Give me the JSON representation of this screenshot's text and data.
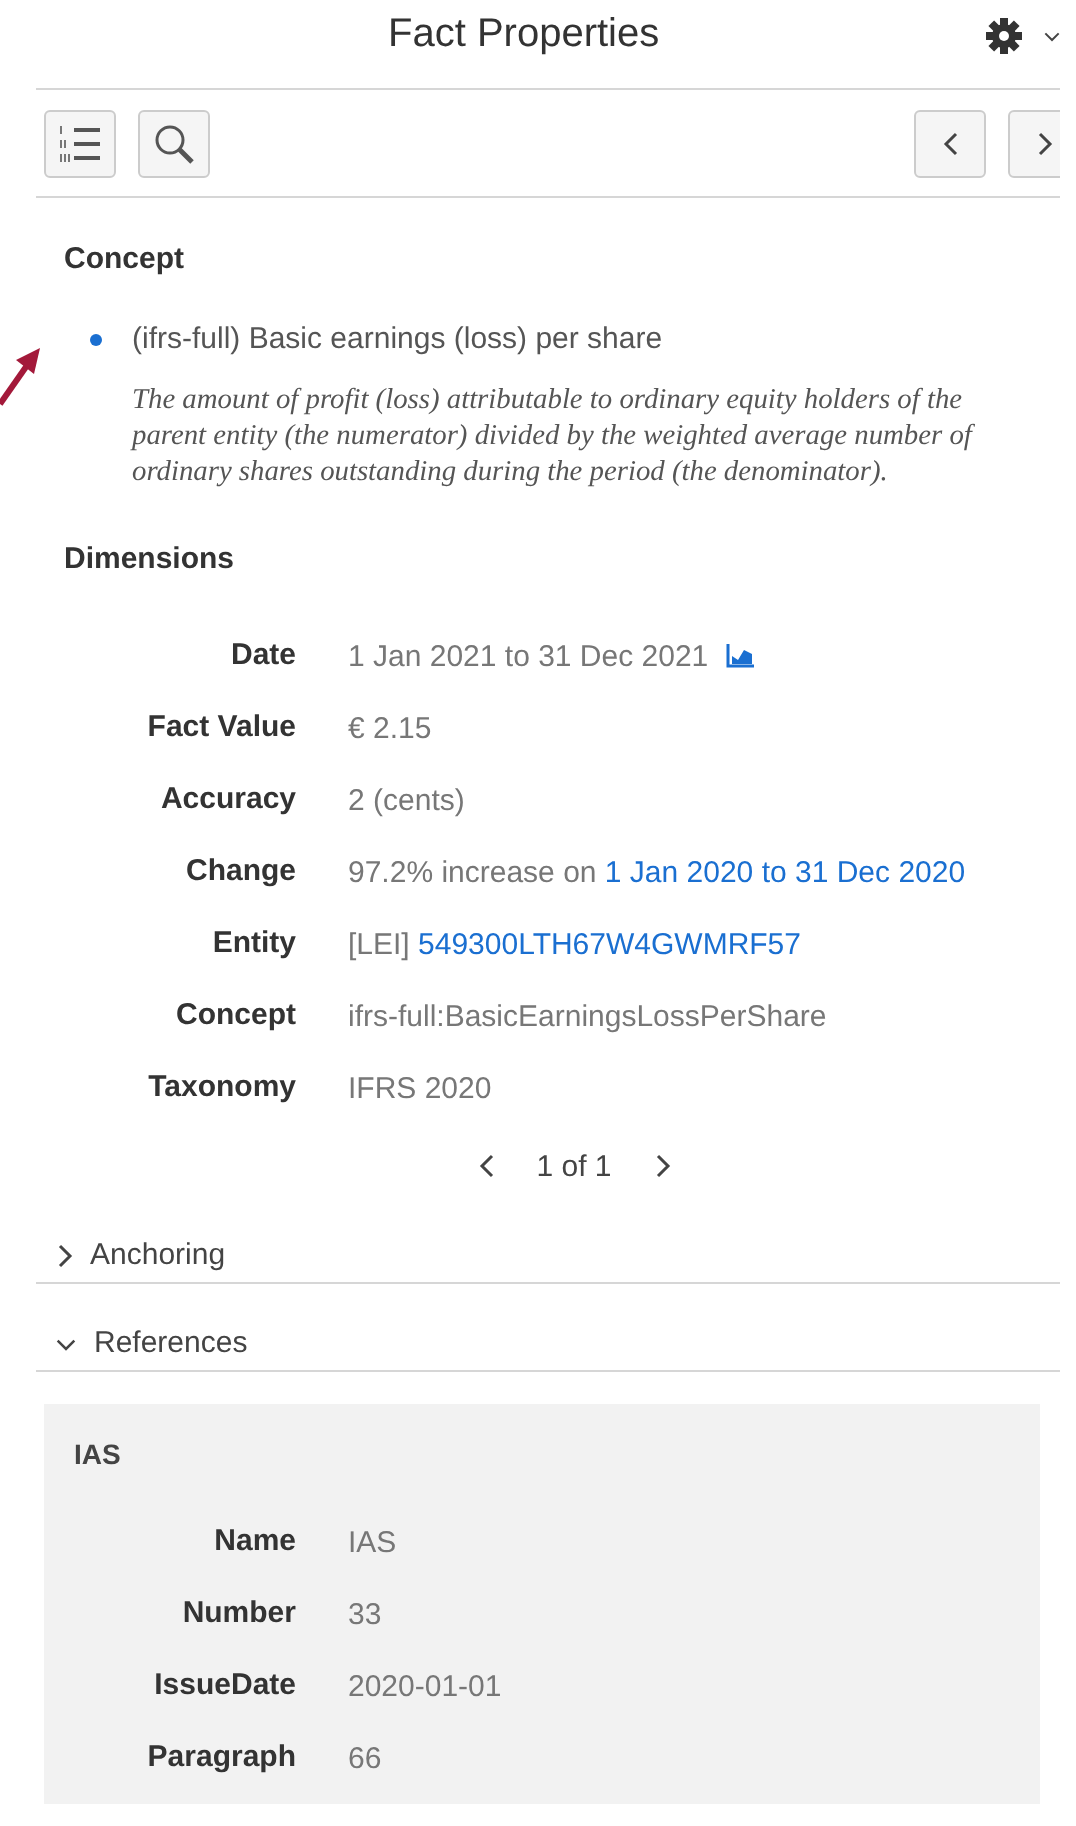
{
  "panel": {
    "title": "Fact Properties"
  },
  "concept": {
    "heading": "Concept",
    "name": "(ifrs-full) Basic earnings (loss) per share",
    "description": "The amount of profit (loss) attributable to ordinary equity holders of the parent entity (the numerator) divided by the weighted average number of ordinary shares outstanding during the period (the denominator)."
  },
  "dimensions": {
    "heading": "Dimensions",
    "rows": [
      {
        "label": "Date",
        "kind": "trend",
        "value": "1 Jan 2021 to 31 Dec 2021"
      },
      {
        "label": "Fact Value",
        "kind": "text",
        "value": "€ 2.15"
      },
      {
        "label": "Accuracy",
        "kind": "text",
        "value": "2 (cents)"
      },
      {
        "label": "Change",
        "kind": "link",
        "value": "97.2% increase on",
        "link": "1 Jan 2020 to 31 Dec 2020"
      },
      {
        "label": "Entity",
        "kind": "link",
        "value": "[LEI]",
        "link": "549300LTH67W4GWMRF57"
      },
      {
        "label": "Concept",
        "kind": "text",
        "value": "ifrs-full:BasicEarningsLossPerShare"
      },
      {
        "label": "Taxonomy",
        "kind": "text",
        "value": "IFRS 2020"
      }
    ],
    "pager": "1 of 1"
  },
  "sections": [
    {
      "title": "Anchoring",
      "expanded": false
    },
    {
      "title": "References",
      "expanded": true
    }
  ],
  "references": [
    {
      "title": "IAS",
      "rows": [
        {
          "label": "Name",
          "value": "IAS"
        },
        {
          "label": "Number",
          "value": "33"
        },
        {
          "label": "IssueDate",
          "value": "2020-01-01"
        },
        {
          "label": "Paragraph",
          "value": "66"
        }
      ]
    }
  ]
}
